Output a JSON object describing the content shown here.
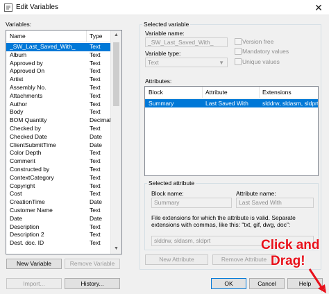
{
  "window": {
    "title": "Edit Variables",
    "close_glyph": "✕"
  },
  "variables": {
    "label": "Variables:",
    "col_name": "Name",
    "col_type": "Type",
    "rows": [
      {
        "name": "_SW_Last_Saved_With_",
        "type": "Text",
        "selected": true
      },
      {
        "name": "Album",
        "type": "Text"
      },
      {
        "name": "Approved by",
        "type": "Text"
      },
      {
        "name": "Approved On",
        "type": "Text"
      },
      {
        "name": "Artist",
        "type": "Text"
      },
      {
        "name": "Assembly No.",
        "type": "Text"
      },
      {
        "name": "Attachments",
        "type": "Text"
      },
      {
        "name": "Author",
        "type": "Text"
      },
      {
        "name": "Body",
        "type": "Text"
      },
      {
        "name": "BOM Quantity",
        "type": "Decimal n..."
      },
      {
        "name": "Checked by",
        "type": "Text"
      },
      {
        "name": "Checked Date",
        "type": "Date"
      },
      {
        "name": "ClientSubmitTime",
        "type": "Date"
      },
      {
        "name": "Color Depth",
        "type": "Text"
      },
      {
        "name": "Comment",
        "type": "Text"
      },
      {
        "name": "Constructed by",
        "type": "Text"
      },
      {
        "name": "ContextCategory",
        "type": "Text"
      },
      {
        "name": "Copyright",
        "type": "Text"
      },
      {
        "name": "Cost",
        "type": "Text"
      },
      {
        "name": "CreationTime",
        "type": "Date"
      },
      {
        "name": "Customer Name",
        "type": "Text"
      },
      {
        "name": "Date",
        "type": "Date"
      },
      {
        "name": "Description",
        "type": "Text"
      },
      {
        "name": "Description 2",
        "type": "Text"
      },
      {
        "name": "Dest. doc. ID",
        "type": "Text"
      }
    ],
    "new_label": "New Variable",
    "remove_label": "Remove Variable",
    "import_label": "Import...",
    "history_label": "History..."
  },
  "selected_variable": {
    "group_label": "Selected variable",
    "name_label": "Variable name:",
    "name_value": "_SW_Last_Saved_With_",
    "type_label": "Variable type:",
    "type_value": "Text",
    "version_free": "Version free",
    "mandatory": "Mandatory values",
    "unique": "Unique values"
  },
  "attributes": {
    "label": "Attributes:",
    "col_block": "Block",
    "col_attribute": "Attribute",
    "col_extensions": "Extensions",
    "rows": [
      {
        "block": "Summary",
        "attribute": "Last Saved With",
        "extensions": "slddrw, sldasm, sldprt"
      }
    ]
  },
  "selected_attribute": {
    "group_label": "Selected attribute",
    "block_label": "Block name:",
    "block_value": "Summary",
    "attr_label": "Attribute name:",
    "attr_value": "Last Saved With",
    "help_text": "File extensions for which the attribute is valid. Separate extensions with commas, like this: \"txt, gif, dwg, doc\":",
    "ext_value": "slddrw, sldasm, sldprt",
    "new_label": "New Attribute",
    "remove_label": "Remove Attribute"
  },
  "footer": {
    "ok": "OK",
    "cancel": "Cancel",
    "help": "Help"
  },
  "annotation": {
    "line1": "Click and",
    "line2": "Drag!",
    "color": "#e8101a"
  }
}
